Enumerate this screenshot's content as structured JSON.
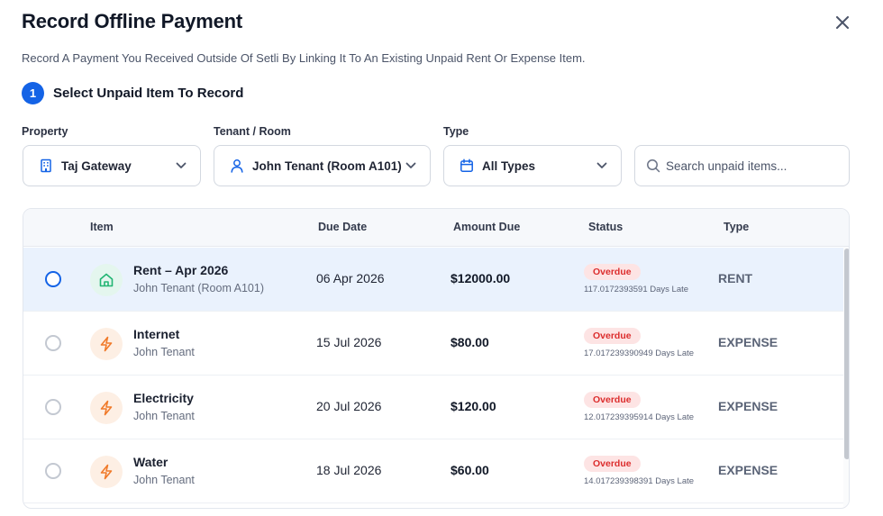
{
  "modal": {
    "title": "Record Offline Payment",
    "subtitle": "Record A Payment You Received Outside Of Setli By Linking It To An Existing Unpaid Rent Or Expense Item."
  },
  "step": {
    "number": "1",
    "label": "Select Unpaid Item To Record"
  },
  "filters": {
    "property": {
      "label": "Property",
      "value": "Taj Gateway"
    },
    "tenant": {
      "label": "Tenant / Room",
      "value": "John Tenant (Room A101)"
    },
    "type": {
      "label": "Type",
      "value": "All Types"
    },
    "search": {
      "placeholder": "Search unpaid items...",
      "value": ""
    }
  },
  "table": {
    "headers": {
      "item": "Item",
      "due_date": "Due Date",
      "amount": "Amount Due",
      "status": "Status",
      "type": "Type"
    },
    "rows": [
      {
        "name": "Rent – Apr 2026",
        "tenant": "John Tenant (Room A101)",
        "due": "06 Apr 2026",
        "amount": "$12000.00",
        "status": "Overdue",
        "late": "117.0172393591 Days Late",
        "type": "RENT",
        "icon": "home-icon",
        "selected": true
      },
      {
        "name": "Internet",
        "tenant": "John Tenant",
        "due": "15 Jul 2026",
        "amount": "$80.00",
        "status": "Overdue",
        "late": "17.017239390949 Days Late",
        "type": "EXPENSE",
        "icon": "lightning-icon",
        "selected": false
      },
      {
        "name": "Electricity",
        "tenant": "John Tenant",
        "due": "20 Jul 2026",
        "amount": "$120.00",
        "status": "Overdue",
        "late": "12.017239395914 Days Late",
        "type": "EXPENSE",
        "icon": "lightning-icon",
        "selected": false
      },
      {
        "name": "Water",
        "tenant": "John Tenant",
        "due": "18 Jul 2026",
        "amount": "$60.00",
        "status": "Overdue",
        "late": "14.017239398391 Days Late",
        "type": "EXPENSE",
        "icon": "lightning-icon",
        "selected": false
      }
    ]
  },
  "colors": {
    "accent": "#1463e6",
    "overdue_text": "#dc2d2d",
    "overdue_bg": "#fde4e4",
    "rent_icon": "#22b573",
    "expense_icon": "#f07a2a",
    "selected_row_bg": "#eaf2fd"
  }
}
